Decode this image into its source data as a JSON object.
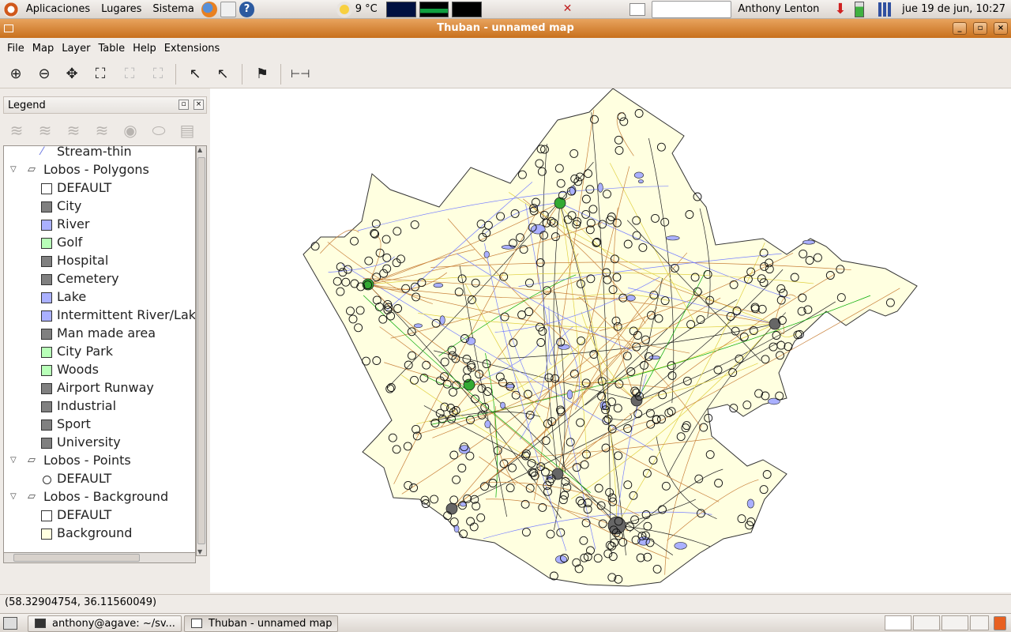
{
  "top_panel": {
    "menus": [
      "Aplicaciones",
      "Lugares",
      "Sistema"
    ],
    "weather": "9 °C",
    "user": "Anthony Lenton",
    "clock": "jue 19 de jun, 10:27"
  },
  "window": {
    "title": "Thuban - unnamed map",
    "buttons": [
      "_",
      "▫",
      "×"
    ]
  },
  "menubar": [
    "File",
    "Map",
    "Layer",
    "Table",
    "Help",
    "Extensions"
  ],
  "toolbar": {
    "icons": [
      "zoom-in-icon",
      "zoom-out-icon",
      "pan-icon",
      "full-extent-icon",
      "full-layer-extent-icon",
      "full-selection-extent-icon",
      "identify-icon",
      "label-icon",
      "select-icon",
      "scalebar-icon"
    ]
  },
  "legend": {
    "title": "Legend",
    "items": [
      {
        "label": "Stream-thin",
        "kind": "line",
        "color": "#6c78e0"
      },
      {
        "label": "Lobos - Polygons",
        "kind": "layer"
      },
      {
        "label": "DEFAULT",
        "kind": "swatch",
        "color": "#ffffff"
      },
      {
        "label": "City",
        "kind": "swatch",
        "color": "#808080"
      },
      {
        "label": "River",
        "kind": "swatch",
        "color": "#aab0ff"
      },
      {
        "label": "Golf",
        "kind": "swatch",
        "color": "#b8ffb8"
      },
      {
        "label": "Hospital",
        "kind": "swatch",
        "color": "#808080"
      },
      {
        "label": "Cemetery",
        "kind": "swatch",
        "color": "#808080"
      },
      {
        "label": "Lake",
        "kind": "swatch",
        "color": "#aab0ff"
      },
      {
        "label": "Intermittent River/Lake",
        "kind": "swatch",
        "color": "#aab0ff"
      },
      {
        "label": "Man made area",
        "kind": "swatch",
        "color": "#808080"
      },
      {
        "label": "City Park",
        "kind": "swatch",
        "color": "#b8ffb8"
      },
      {
        "label": "Woods",
        "kind": "swatch",
        "color": "#b8ffb8"
      },
      {
        "label": "Airport Runway",
        "kind": "swatch",
        "color": "#808080"
      },
      {
        "label": "Industrial",
        "kind": "swatch",
        "color": "#808080"
      },
      {
        "label": "Sport",
        "kind": "swatch",
        "color": "#808080"
      },
      {
        "label": "University",
        "kind": "swatch",
        "color": "#808080"
      },
      {
        "label": "Lobos - Points",
        "kind": "layer"
      },
      {
        "label": "DEFAULT",
        "kind": "point"
      },
      {
        "label": "Lobos - Background",
        "kind": "layer"
      },
      {
        "label": "DEFAULT",
        "kind": "swatch",
        "color": "#ffffff"
      },
      {
        "label": "Background",
        "kind": "swatch",
        "color": "#ffffe0"
      }
    ]
  },
  "status": {
    "coordinates": "(58.32904754, 36.11560049)"
  },
  "taskbar": {
    "tasks": [
      "anthony@agave: ~/sv...",
      "Thuban - unnamed map"
    ]
  },
  "colors": {
    "map_fill": "#ffffe0",
    "title_bar": "#d98a3e",
    "green": "#00aa00",
    "blue": "#7880ff"
  }
}
